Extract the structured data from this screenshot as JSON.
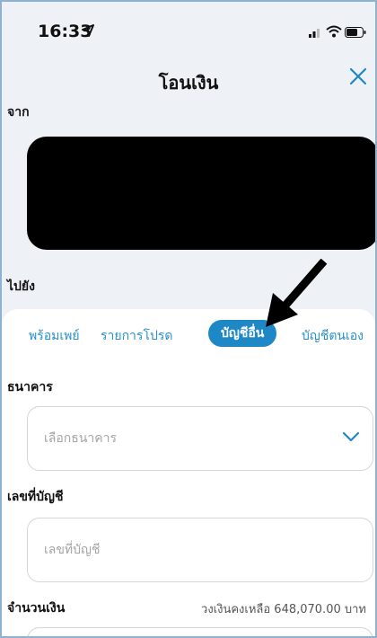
{
  "status_bar": {
    "time": "16:33"
  },
  "header": {
    "title": "โอนเงิน"
  },
  "from": {
    "label": "จาก"
  },
  "to": {
    "label": "ไปยัง",
    "tabs": [
      {
        "label": "พร้อมเพย์"
      },
      {
        "label": "รายการโปรด"
      },
      {
        "label": "บัญชีอื่น",
        "active": true
      },
      {
        "label": "บัญชีตนเอง"
      }
    ]
  },
  "bank": {
    "label": "ธนาคาร",
    "placeholder": "เลือกธนาคาร"
  },
  "account": {
    "label": "เลขที่บัญชี",
    "placeholder": "เลขที่บัญชี"
  },
  "amount": {
    "label": "จำนวนเงิน",
    "balance_text": "วงเงินคงเหลือ 648,070.00 บาท"
  },
  "colors": {
    "accent": "#1e88c7",
    "tab_text": "#2a8fc8",
    "background": "#eef1f6"
  },
  "icons": [
    "location-arrow-icon",
    "signal-icon",
    "wifi-icon",
    "battery-icon",
    "close-icon",
    "chevron-down-icon",
    "pointer-arrow-icon"
  ]
}
